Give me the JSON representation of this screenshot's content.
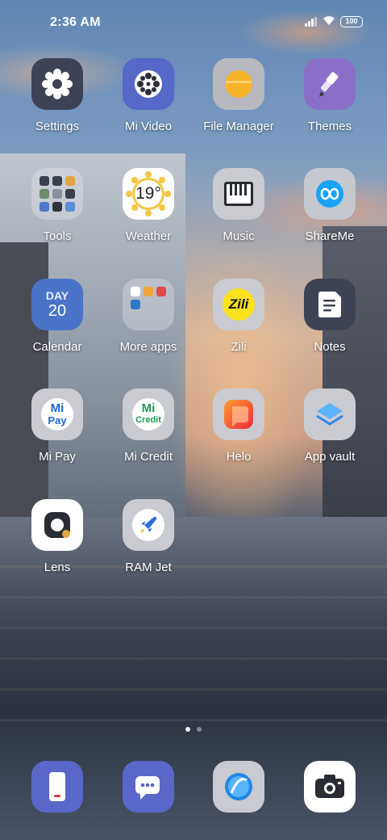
{
  "status_bar": {
    "time": "2:36 AM",
    "battery": "100"
  },
  "apps": [
    {
      "name": "Settings"
    },
    {
      "name": "Mi Video"
    },
    {
      "name": "File Manager"
    },
    {
      "name": "Themes"
    },
    {
      "name": "Tools"
    },
    {
      "name": "Weather",
      "icon_text": "19°"
    },
    {
      "name": "Music"
    },
    {
      "name": "ShareMe"
    },
    {
      "name": "Calendar",
      "day_label": "DAY",
      "date": "20"
    },
    {
      "name": "More apps"
    },
    {
      "name": "Zili",
      "icon_text": "Zili"
    },
    {
      "name": "Notes"
    },
    {
      "name": "Mi Pay",
      "icon_text_top": "Mi",
      "icon_text_bottom": "Pay"
    },
    {
      "name": "Mi Credit",
      "icon_text_top": "Mi",
      "icon_text_bottom": "Credit"
    },
    {
      "name": "Helo"
    },
    {
      "name": "App vault"
    },
    {
      "name": "Lens"
    },
    {
      "name": "RAM Jet"
    }
  ],
  "dock": [
    {
      "name": "phone"
    },
    {
      "name": "messages"
    },
    {
      "name": "browser"
    },
    {
      "name": "camera"
    }
  ],
  "colors": {
    "accent_blue": "#4a7bd8",
    "dock_purple": "#5b66c9"
  }
}
